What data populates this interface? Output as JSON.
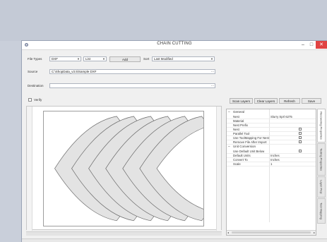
{
  "window": {
    "title": "CHAIN CUTTING",
    "minimize": "–",
    "maximize": "□",
    "close": "✕"
  },
  "toolbar": {
    "file_types_label": "File Types",
    "file_type_value": "DXF",
    "filter_value": "List",
    "add_label": "Add",
    "sort_label": "Sort",
    "sort_value": "Last Modified"
  },
  "source": {
    "label": "Source",
    "value": "C:\\ShopData_v3.5\\Sample DXF",
    "browse": "..."
  },
  "destination": {
    "label": "Destination",
    "value": "",
    "browse": "..."
  },
  "verify": {
    "label": "Verify"
  },
  "actions": {
    "scan_layers": "Scan Layers",
    "clear_layers": "Clear Layers",
    "refresh": "Refresh",
    "save": "Save"
  },
  "properties": {
    "general_header": "General",
    "rows": [
      {
        "key": "Nest",
        "value": "Slurry Sprl 6275"
      },
      {
        "key": "Material",
        "value": ""
      },
      {
        "key": "Nest Prefix",
        "value": ""
      },
      {
        "key": "Nest",
        "value": ""
      },
      {
        "key": "Parallel Tool",
        "value": ""
      },
      {
        "key": "Use ToolMapping For Nest",
        "value": ""
      },
      {
        "key": "Remove File After Import",
        "value": ""
      }
    ],
    "unit_header": "Unit Conversion",
    "unit_rows": [
      {
        "key": "Use Default Unit Below",
        "value": ""
      },
      {
        "key": "Default Units",
        "value": "Inches"
      },
      {
        "key": "Convert To",
        "value": "Inches"
      },
      {
        "key": "Scale",
        "value": "1"
      }
    ]
  },
  "side_tabs": [
    {
      "label": "Recovering Properties"
    },
    {
      "label": "Tooling Properties"
    },
    {
      "label": "Layer Prop"
    },
    {
      "label": "Tool Mapping"
    }
  ],
  "colors": {
    "accent_close": "#e04343",
    "shape_fill": "#e3e3e3",
    "shape_stroke": "#6b6b6b"
  }
}
